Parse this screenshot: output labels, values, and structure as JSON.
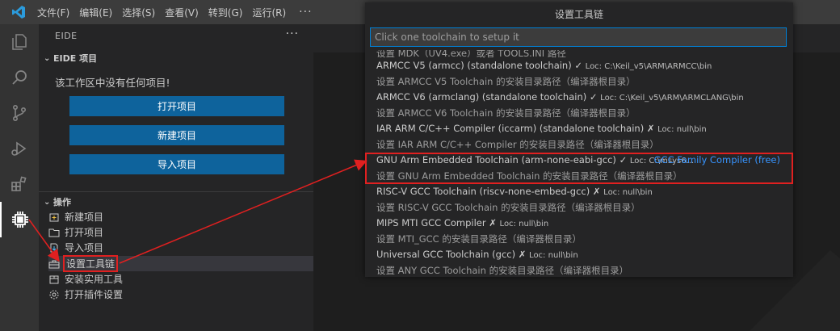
{
  "menubar": {
    "items": [
      "文件(F)",
      "编辑(E)",
      "选择(S)",
      "查看(V)",
      "转到(G)",
      "运行(R)"
    ],
    "more": "···"
  },
  "sidebar": {
    "header": "EIDE",
    "more": "···",
    "project_section": "EIDE 项目",
    "empty_text": "该工作区中没有任何项目!",
    "buttons": {
      "open": "打开项目",
      "new": "新建项目",
      "import": "导入项目"
    },
    "ops_section": "操作",
    "ops": [
      "新建项目",
      "打开项目",
      "导入项目",
      "设置工具链",
      "安装实用工具",
      "打开插件设置"
    ]
  },
  "quickpick": {
    "title": "设置工具链",
    "placeholder": "Click one toolchain to setup it",
    "clipped_text": "设置 MDK（UV4.exe）或者 TOOLS.INI 路径",
    "items": [
      {
        "label": "ARMCC V5 (armcc) (standalone toolchain)",
        "status": "✓",
        "loc": "Loc: C:\\Keil_v5\\ARM\\ARMCC\\bin",
        "desc": "设置 ARMCC V5 Toolchain 的安装目录路径（编译器根目录）",
        "tag": ""
      },
      {
        "label": "ARMCC V6 (armclang) (standalone toolchain)",
        "status": "✓",
        "loc": "Loc: C:\\Keil_v5\\ARM\\ARMCLANG\\bin",
        "desc": "设置 ARMCC V6 Toolchain 的安装目录路径（编译器根目录）",
        "tag": ""
      },
      {
        "label": "IAR ARM C/C++ Compiler (iccarm) (standalone toolchain)",
        "status": "✗",
        "loc": "Loc: null\\bin",
        "desc": "设置 IAR ARM C/C++ Compiler 的安装目录路径（编译器根目录）",
        "tag": ""
      },
      {
        "label": "GNU Arm Embedded Toolchain (arm-none-eabi-gcc)",
        "status": "✓",
        "loc": "Loc: C:\\msys6...",
        "desc": "设置 GNU Arm Embedded Toolchain 的安装目录路径（编译器根目录）",
        "tag": "GCC Family Compiler (free)"
      },
      {
        "label": "RISC-V GCC Toolchain (riscv-none-embed-gcc)",
        "status": "✗",
        "loc": "Loc: null\\bin",
        "desc": "设置 RISC-V GCC Toolchain 的安装目录路径（编译器根目录）",
        "tag": ""
      },
      {
        "label": "MIPS MTI GCC Compiler",
        "status": "✗",
        "loc": "Loc: null\\bin",
        "desc": "设置 MTI_GCC 的安装目录路径（编译器根目录）",
        "tag": ""
      },
      {
        "label": "Universal GCC Toolchain (gcc)",
        "status": "✗",
        "loc": "Loc: null\\bin",
        "desc": "设置 ANY GCC Toolchain 的安装目录路径（编译器根目录）",
        "tag": ""
      }
    ]
  },
  "colors": {
    "accent": "#0e639c",
    "highlight": "#e02020",
    "link": "#3794ff"
  }
}
